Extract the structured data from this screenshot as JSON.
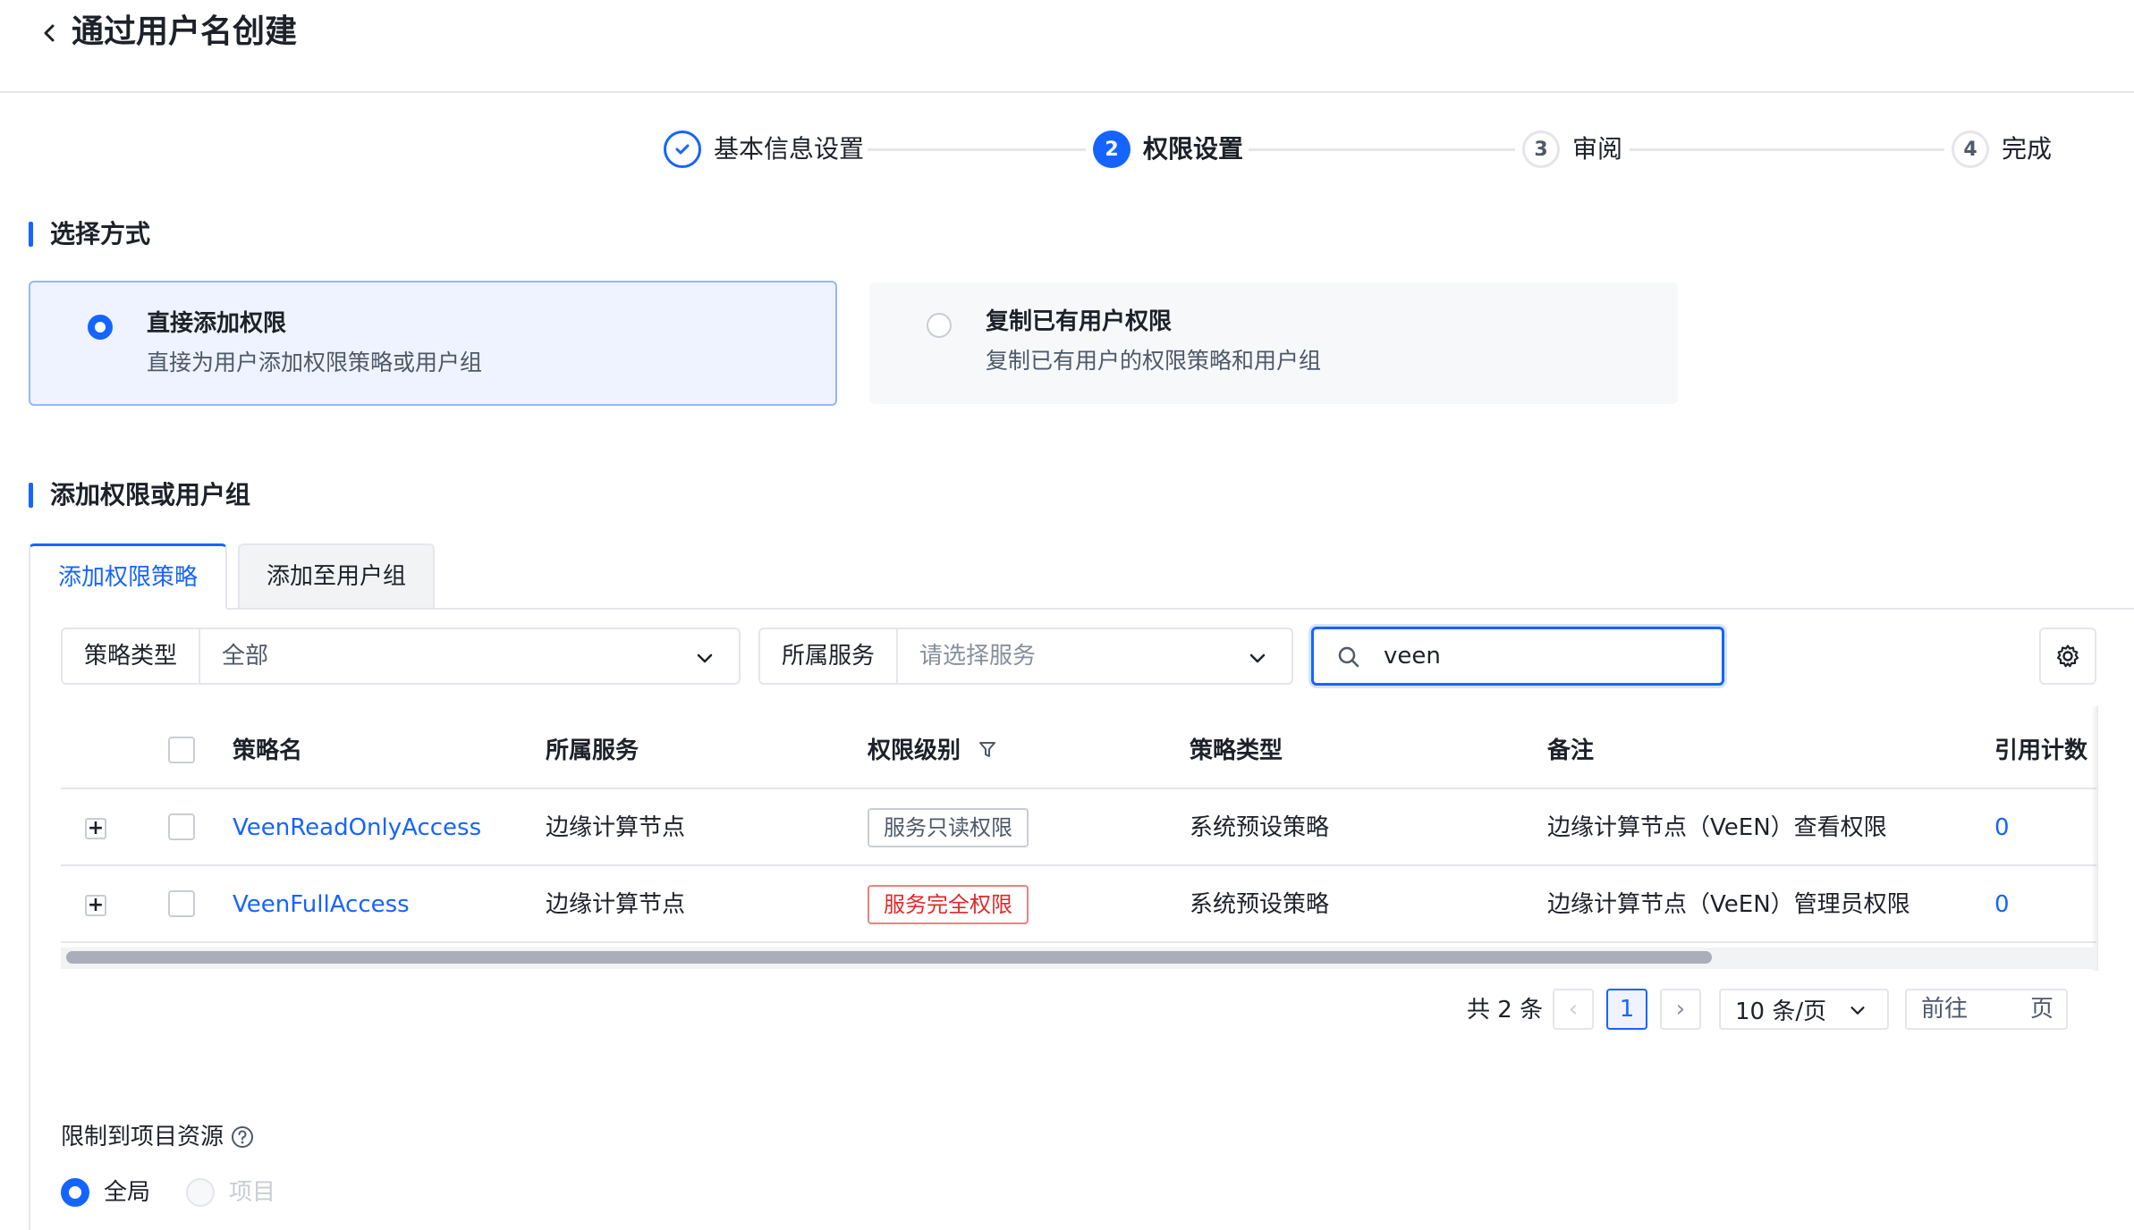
{
  "header": {
    "title": "通过用户名创建"
  },
  "steps": [
    {
      "number": "✓",
      "label": "基本信息设置",
      "state": "done"
    },
    {
      "number": "2",
      "label": "权限设置",
      "state": "active"
    },
    {
      "number": "3",
      "label": "审阅",
      "state": "pending"
    },
    {
      "number": "4",
      "label": "完成",
      "state": "pending"
    }
  ],
  "method_section": {
    "title": "选择方式",
    "options": [
      {
        "title": "直接添加权限",
        "desc": "直接为用户添加权限策略或用户组",
        "selected": true
      },
      {
        "title": "复制已有用户权限",
        "desc": "复制已有用户的权限策略和用户组",
        "selected": false
      }
    ]
  },
  "add_section": {
    "title": "添加权限或用户组",
    "tabs": [
      {
        "label": "添加权限策略",
        "active": true
      },
      {
        "label": "添加至用户组",
        "active": false
      }
    ]
  },
  "filters": {
    "policy_type": {
      "label": "策略类型",
      "value": "全部"
    },
    "service": {
      "label": "所属服务",
      "placeholder": "请选择服务"
    },
    "search": {
      "value": "veen"
    }
  },
  "table": {
    "headers": [
      "策略名",
      "所属服务",
      "权限级别",
      "策略类型",
      "备注",
      "引用计数"
    ],
    "rows": [
      {
        "name": "VeenReadOnlyAccess",
        "service": "边缘计算节点",
        "level": "服务只读权限",
        "level_kind": "readonly",
        "type": "系统预设策略",
        "note": "边缘计算节点（VeEN）查看权限",
        "count": "0"
      },
      {
        "name": "VeenFullAccess",
        "service": "边缘计算节点",
        "level": "服务完全权限",
        "level_kind": "full",
        "type": "系统预设策略",
        "note": "边缘计算节点（VeEN）管理员权限",
        "count": "0"
      }
    ]
  },
  "pagination": {
    "total": "共 2 条",
    "prev": "‹",
    "current_page": "1",
    "next": "›",
    "page_size": "10 条/页",
    "goto_label": "前往",
    "goto_suffix": "页"
  },
  "scope": {
    "title": "限制到项目资源",
    "options": [
      {
        "label": "全局",
        "selected": true
      },
      {
        "label": "项目",
        "selected": false,
        "disabled": true
      }
    ]
  },
  "colors": {
    "primary": "#1664ff",
    "card_selected_bg": "#eef3ff",
    "card_unselected_bg": "#f7f8fa",
    "danger": "#e02929"
  }
}
